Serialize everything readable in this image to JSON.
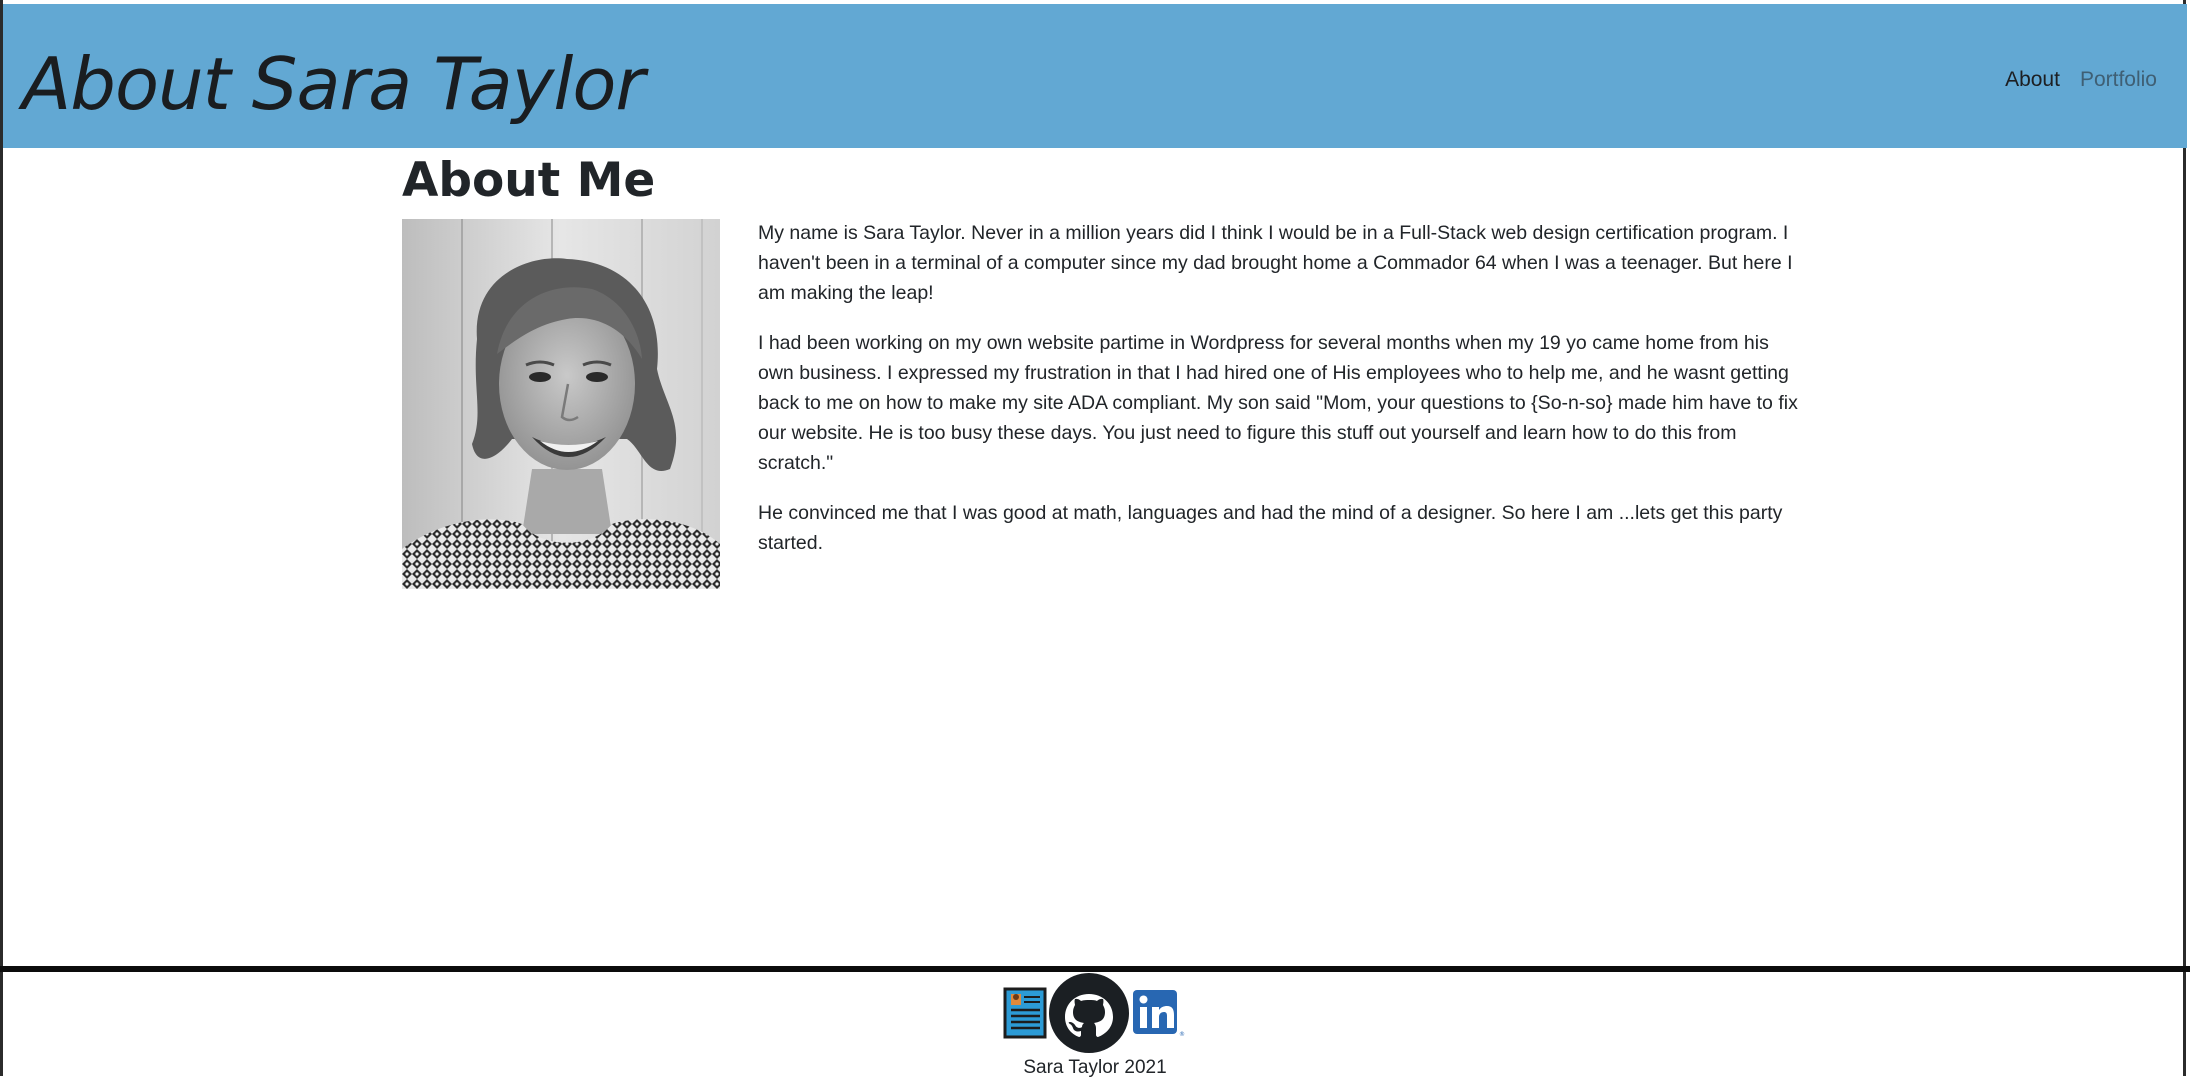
{
  "header": {
    "title": "About Sara Taylor",
    "background_color": "#62a8d3",
    "nav": [
      {
        "label": "About",
        "active": true
      },
      {
        "label": "Portfolio",
        "active": false
      }
    ]
  },
  "main": {
    "heading": "About Me",
    "photo": "portrait-photo",
    "paragraphs": [
      "My name is Sara Taylor. Never in a million years did I think I would be in a Full-Stack web design certification program. I haven't been in a terminal of a computer since my dad brought home a Commador 64 when I was a teenager. But here I am making the leap!",
      "I had been working on my own website partime in Wordpress for several months when my 19 yo came home from his own business. I expressed my frustration in that I had hired one of His employees who to help me, and he wasnt getting back to me on how to make my site ADA compliant. My son said \"Mom, your questions to {So-n-so} made him have to fix our website. He is too busy these days. You just need to figure this stuff out yourself and learn how to do this from scratch.\"",
      "He convinced me that I was good at math, languages and had the mind of a designer. So here I am ...lets get this party started."
    ]
  },
  "footer": {
    "icons": [
      "resume-icon",
      "github-icon",
      "linkedin-icon"
    ],
    "text": "Sara Taylor 2021"
  }
}
